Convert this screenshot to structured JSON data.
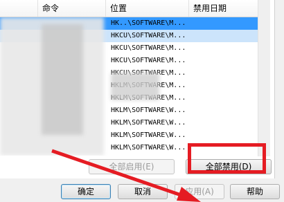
{
  "columns": {
    "command": "命令",
    "location": "位置",
    "disabled_date": "禁用日期"
  },
  "rows": [
    {
      "location": "HK..\\SOFTWARE\\M..."
    },
    {
      "location": "HKCU\\SOFTWARE\\M..."
    },
    {
      "location": "HKCU\\SOFTWARE\\M..."
    },
    {
      "location": "HKCU\\SOFTWARE\\M..."
    },
    {
      "location": "HKCU\\SOFTWARE\\M..."
    },
    {
      "location": "HKLM\\SOFTWARE\\M..."
    },
    {
      "location": "HKLM\\SOFTWARE\\M..."
    },
    {
      "location": "HKLM\\SOFTWARE\\W..."
    },
    {
      "location": "HKLM\\SOFTWARE\\W..."
    },
    {
      "location": "HKLM\\SOFTWARE\\W..."
    },
    {
      "location": "HKLM\\SOFTWARE\\W..."
    }
  ],
  "buttons": {
    "enable_all": "全部启用(E)",
    "disable_all": "全部禁用(D)",
    "ok": "确定",
    "cancel": "取消",
    "apply": "应用(A)",
    "help": "帮助"
  },
  "colors": {
    "highlight": "#e51c23",
    "selection": "#3399ff"
  }
}
